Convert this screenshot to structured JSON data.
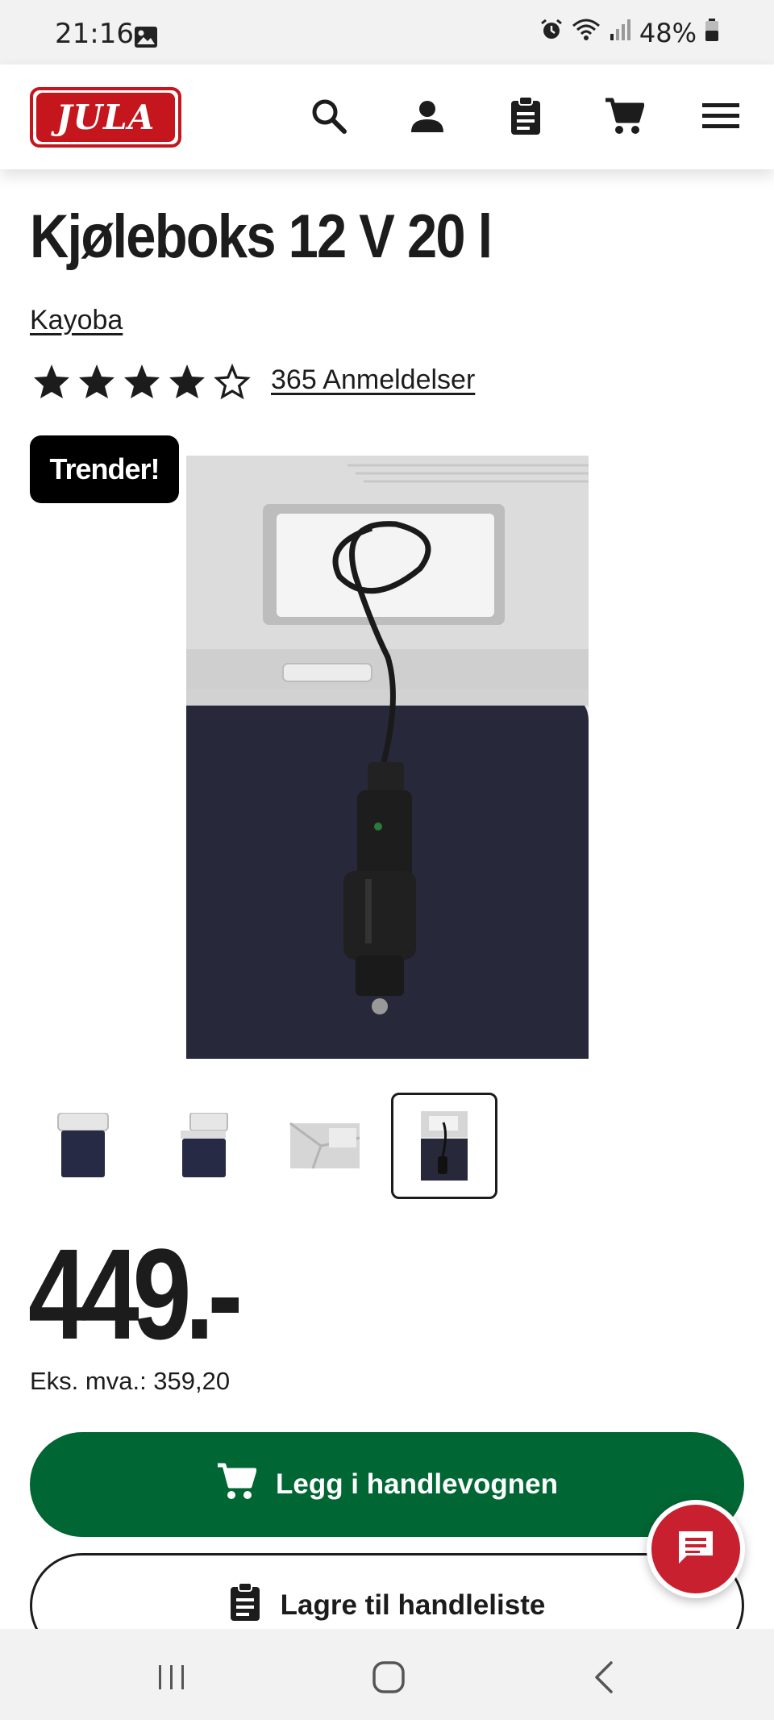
{
  "status_bar": {
    "time": "21:16",
    "battery": "48%",
    "icons": [
      "image-icon",
      "alarm-icon",
      "wifi-icon",
      "signal-icon",
      "battery-icon"
    ]
  },
  "header": {
    "logo_text": "JULA",
    "icons": [
      "search-icon",
      "account-icon",
      "shopping-list-icon",
      "cart-icon",
      "menu-icon"
    ]
  },
  "product": {
    "title": "Kjøleboks 12 V 20 l",
    "brand": "Kayoba",
    "rating": 4,
    "rating_max": 5,
    "reviews_label": "365 Anmeldelser",
    "badge": "Trender!",
    "thumbnails": [
      "cooler-closed",
      "cooler-open",
      "cooler-interior",
      "cooler-cable"
    ],
    "selected_thumbnail": 3,
    "price": "449.-",
    "vat_label": "Eks. mva.: 359,20"
  },
  "actions": {
    "add_to_cart": "Legg i handlevognen",
    "save_to_list": "Lagre til handleliste"
  },
  "colors": {
    "brand_red": "#c4161c",
    "cart_green": "#006633",
    "chat_red": "#c8202f"
  },
  "nav": [
    "recent-apps-icon",
    "home-icon",
    "back-icon"
  ]
}
